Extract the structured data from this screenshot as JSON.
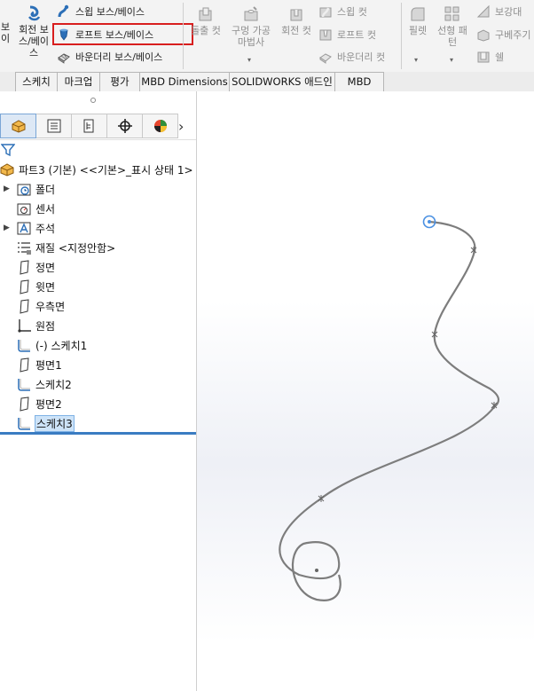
{
  "ribbon": {
    "left_cut_1": "보\n이",
    "revolve_label": "회전 보\n스/베이\n스",
    "sweep_boss": "스윕 보스/베이스",
    "loft_boss": "로프트 보스/베이스",
    "boundary_boss": "바운더리 보스/베이스",
    "extrude_cut": "돌출 컷",
    "hole_wizard": "구멍 가공\n마법사",
    "revolve_cut": "회전 컷",
    "swept_cut": "스윕 컷",
    "lofted_cut": "로프트 컷",
    "boundary_cut": "바운더리 컷",
    "fillet": "필렛",
    "linear_pattern": "선형 패\n턴",
    "rib": "보강대",
    "wrap": "구베주기",
    "shell": "쉘"
  },
  "tabs": [
    "스케치",
    "마크업",
    "평가",
    "MBD Dimensions",
    "SOLIDWORKS 애드인",
    "MBD"
  ],
  "panel": {
    "more_arrow": "›"
  },
  "tree": {
    "root": "파트3 (기본) <<기본>_표시 상태 1>",
    "items": [
      {
        "label": "폴더",
        "icon": "history-folder-icon",
        "expandable": true
      },
      {
        "label": "센서",
        "icon": "sensor-icon",
        "expandable": false
      },
      {
        "label": "주석",
        "icon": "annotation-icon",
        "expandable": true
      },
      {
        "label": "재질 <지정안함>",
        "icon": "material-icon",
        "expandable": false
      },
      {
        "label": "정면",
        "icon": "plane-icon",
        "expandable": false
      },
      {
        "label": "윗면",
        "icon": "plane-icon",
        "expandable": false
      },
      {
        "label": "우측면",
        "icon": "plane-icon",
        "expandable": false
      },
      {
        "label": "원점",
        "icon": "origin-icon",
        "expandable": false
      },
      {
        "label": "(-) 스케치1",
        "icon": "sketch-icon",
        "expandable": false
      },
      {
        "label": "평면1",
        "icon": "plane-icon",
        "expandable": false
      },
      {
        "label": "스케치2",
        "icon": "sketch-icon",
        "expandable": false
      },
      {
        "label": "평면2",
        "icon": "plane-icon",
        "expandable": false
      },
      {
        "label": "스케치3",
        "icon": "sketch-icon",
        "expandable": false,
        "selected": true
      }
    ]
  },
  "colors": {
    "accent": "#3a7cc2",
    "highlight_box": "#d81e1e",
    "curve": "#7d7d7d",
    "selected_endpoint": "#4a90e2"
  }
}
